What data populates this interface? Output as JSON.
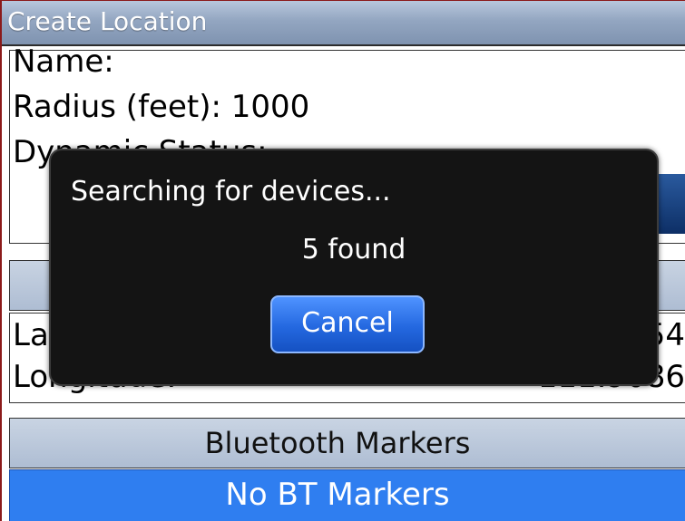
{
  "window": {
    "title": "Create Location"
  },
  "form": {
    "name_label": "Name:",
    "radius_label": "Radius (feet): 1000",
    "dynamic_status_label": "Dynamic Status:"
  },
  "location": {
    "latitude_label": "La",
    "latitude_value": "54",
    "longitude_label": "Longitude:",
    "longitude_value": "-111.9086"
  },
  "bluetooth": {
    "header": "Bluetooth Markers",
    "items": [
      "No BT Markers"
    ]
  },
  "dialog": {
    "message": "Searching for devices...",
    "count_text": "5 found",
    "cancel_label": "Cancel"
  },
  "colors": {
    "title_bar": "#93a6c1",
    "selection_blue": "#2f7ef0",
    "dialog_bg": "#141414",
    "button_blue": "#2468e0"
  }
}
